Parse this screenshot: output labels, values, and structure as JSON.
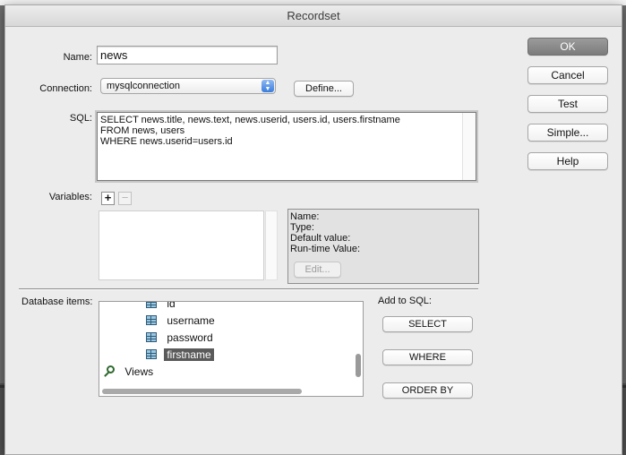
{
  "window": {
    "title": "Recordset"
  },
  "form": {
    "name_label": "Name:",
    "name_value": "news",
    "connection_label": "Connection:",
    "connection_value": "mysqlconnection",
    "define_label": "Define...",
    "sql_label": "SQL:",
    "sql_lines": [
      "SELECT news.title, news.text, news.userid, users.id, users.firstname",
      "FROM news, users",
      "WHERE news.userid=users.id"
    ],
    "variables_label": "Variables:",
    "add_symbol": "+",
    "remove_symbol": "−"
  },
  "variable_info": {
    "name_label": "Name:",
    "type_label": "Type:",
    "default_label": "Default value:",
    "runtime_label": "Run-time Value:",
    "edit_label": "Edit..."
  },
  "actions": {
    "ok": "OK",
    "cancel": "Cancel",
    "test": "Test",
    "simple": "Simple...",
    "help": "Help"
  },
  "database": {
    "label": "Database items:",
    "items": [
      {
        "label": "id",
        "icon": "column-icon"
      },
      {
        "label": "username",
        "icon": "column-icon"
      },
      {
        "label": "password",
        "icon": "column-icon"
      },
      {
        "label": "firstname",
        "icon": "column-icon",
        "selected": true
      }
    ],
    "views_label": "Views"
  },
  "add_to_sql": {
    "label": "Add to SQL:",
    "select": "SELECT",
    "where": "WHERE",
    "order_by": "ORDER BY"
  }
}
